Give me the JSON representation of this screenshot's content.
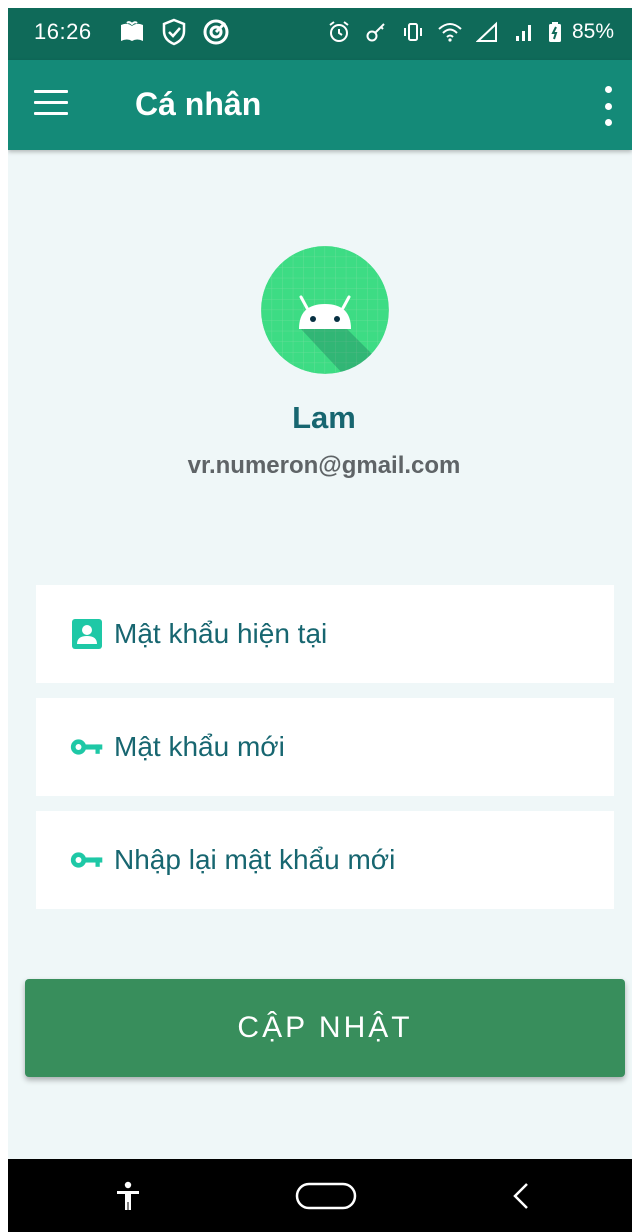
{
  "status_bar": {
    "time": "16:26",
    "battery": "85%",
    "left_icons": [
      "book-icon",
      "shield-check-icon",
      "vpn-icon"
    ],
    "right_icons": [
      "alarm-icon",
      "key-icon",
      "vibrate-icon",
      "wifi-icon",
      "signal-empty-icon",
      "signal-bars-icon",
      "battery-icon"
    ]
  },
  "app_bar": {
    "title": "Cá nhân",
    "menu_icon": "hamburger-menu-icon",
    "more_icon": "more-vert-icon"
  },
  "profile": {
    "name": "Lam",
    "email": "vr.numeron@gmail.com",
    "avatar_icon": "android-icon"
  },
  "form": {
    "current_password": {
      "placeholder": "Mật khẩu hiện tại",
      "icon": "account-box-icon"
    },
    "new_password": {
      "placeholder": "Mật khẩu mới",
      "icon": "key-icon"
    },
    "confirm_password": {
      "placeholder": "Nhập lại mật khẩu mới",
      "icon": "key-icon"
    },
    "submit_label": "CẬP NHẬT"
  },
  "nav_bar": {
    "items": [
      "accessibility-icon",
      "home-pill-icon",
      "back-icon"
    ]
  },
  "colors": {
    "status_bar": "#0f6a59",
    "app_bar": "#148a78",
    "background": "#eff7f8",
    "accent_text": "#176670",
    "icon_teal": "#1ec8a6",
    "button": "#388e5c"
  }
}
